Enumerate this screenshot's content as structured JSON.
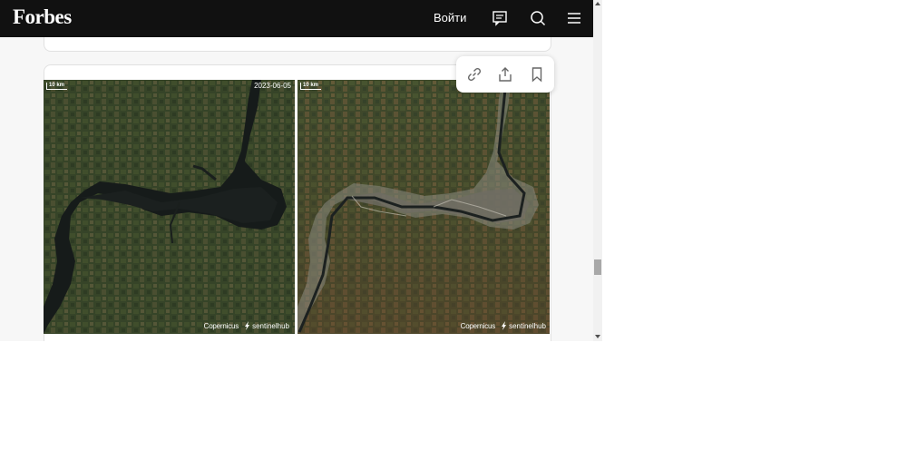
{
  "header": {
    "logo": "Forbes",
    "login_label": "Войти",
    "icons": [
      "comments-icon",
      "search-icon",
      "menu-icon"
    ]
  },
  "share_popup": {
    "icons": [
      "link-icon",
      "share-icon",
      "bookmark-icon"
    ]
  },
  "gallery": {
    "left_image": {
      "scale_label": "10 km",
      "date": "2023-06-05",
      "credit_copernicus": "opernicus",
      "credit_sentinel": "sentinelhub"
    },
    "right_image": {
      "scale_label": "10 km",
      "credit_copernicus": "opernicus",
      "credit_sentinel": "sentinelhub"
    }
  },
  "colors": {
    "header_bg": "#111111",
    "page_bg": "#f7f7f7",
    "land_green": "#3c4a2a",
    "water_dark": "#1a1e1c"
  }
}
